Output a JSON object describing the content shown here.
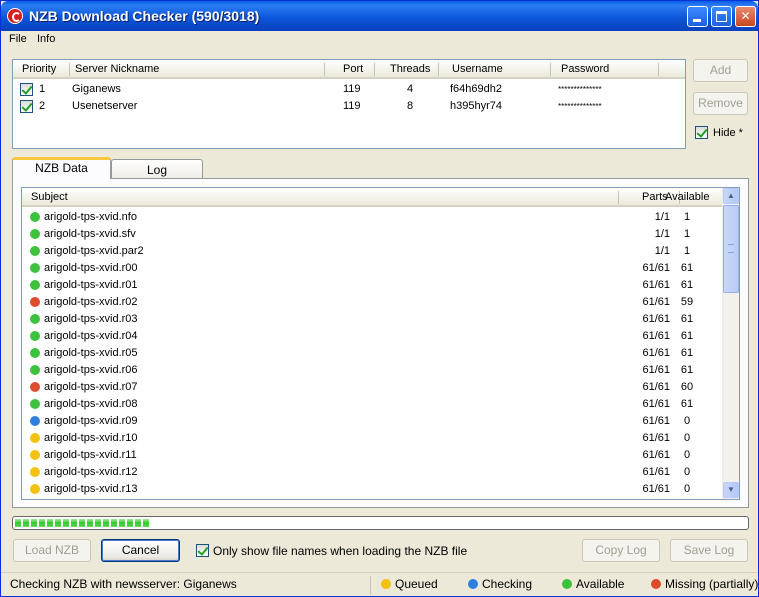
{
  "window": {
    "title": "NZB Download Checker (590/3018)"
  },
  "menu": [
    "File",
    "Info"
  ],
  "servers": {
    "columns": [
      "Priority",
      "Server Nickname",
      "Port",
      "Threads",
      "Username",
      "Password"
    ],
    "rows": [
      {
        "priority": "1",
        "nickname": "Giganews",
        "port": "119",
        "threads": "4",
        "username": "f64h69dh2",
        "password": "**************"
      },
      {
        "priority": "2",
        "nickname": "Usenetserver",
        "port": "119",
        "threads": "8",
        "username": "h395hyr74",
        "password": "**************"
      }
    ],
    "add_label": "Add",
    "remove_label": "Remove",
    "hide_label": "Hide *"
  },
  "tabs": [
    "NZB Data",
    "Log"
  ],
  "nzb": {
    "columns": [
      "Subject",
      "Parts",
      "Available"
    ],
    "rows": [
      {
        "status": "green",
        "subject": "arigold-tps-xvid.nfo",
        "parts": "1/1",
        "available": "1"
      },
      {
        "status": "green",
        "subject": "arigold-tps-xvid.sfv",
        "parts": "1/1",
        "available": "1"
      },
      {
        "status": "green",
        "subject": "arigold-tps-xvid.par2",
        "parts": "1/1",
        "available": "1"
      },
      {
        "status": "green",
        "subject": "arigold-tps-xvid.r00",
        "parts": "61/61",
        "available": "61"
      },
      {
        "status": "green",
        "subject": "arigold-tps-xvid.r01",
        "parts": "61/61",
        "available": "61"
      },
      {
        "status": "red",
        "subject": "arigold-tps-xvid.r02",
        "parts": "61/61",
        "available": "59"
      },
      {
        "status": "green",
        "subject": "arigold-tps-xvid.r03",
        "parts": "61/61",
        "available": "61"
      },
      {
        "status": "green",
        "subject": "arigold-tps-xvid.r04",
        "parts": "61/61",
        "available": "61"
      },
      {
        "status": "green",
        "subject": "arigold-tps-xvid.r05",
        "parts": "61/61",
        "available": "61"
      },
      {
        "status": "green",
        "subject": "arigold-tps-xvid.r06",
        "parts": "61/61",
        "available": "61"
      },
      {
        "status": "red",
        "subject": "arigold-tps-xvid.r07",
        "parts": "61/61",
        "available": "60"
      },
      {
        "status": "green",
        "subject": "arigold-tps-xvid.r08",
        "parts": "61/61",
        "available": "61"
      },
      {
        "status": "blue",
        "subject": "arigold-tps-xvid.r09",
        "parts": "61/61",
        "available": "0"
      },
      {
        "status": "yellow",
        "subject": "arigold-tps-xvid.r10",
        "parts": "61/61",
        "available": "0"
      },
      {
        "status": "yellow",
        "subject": "arigold-tps-xvid.r11",
        "parts": "61/61",
        "available": "0"
      },
      {
        "status": "yellow",
        "subject": "arigold-tps-xvid.r12",
        "parts": "61/61",
        "available": "0"
      },
      {
        "status": "yellow",
        "subject": "arigold-tps-xvid.r13",
        "parts": "61/61",
        "available": "0"
      }
    ]
  },
  "progress": {
    "fraction": 0.195
  },
  "actions": {
    "load_label": "Load NZB",
    "cancel_label": "Cancel",
    "only_names_label": "Only show file names when loading the NZB file",
    "copy_log_label": "Copy Log",
    "save_log_label": "Save Log"
  },
  "status": {
    "message": "Checking NZB with newsserver: Giganews",
    "legend": [
      {
        "key": "yellow",
        "label": "Queued"
      },
      {
        "key": "blue",
        "label": "Checking"
      },
      {
        "key": "green",
        "label": "Available"
      },
      {
        "key": "red",
        "label": "Missing (partially)"
      }
    ]
  },
  "colors": {
    "green": "#3CC23C",
    "red": "#E04A2E",
    "blue": "#2E7FE0",
    "yellow": "#F2C20F"
  }
}
